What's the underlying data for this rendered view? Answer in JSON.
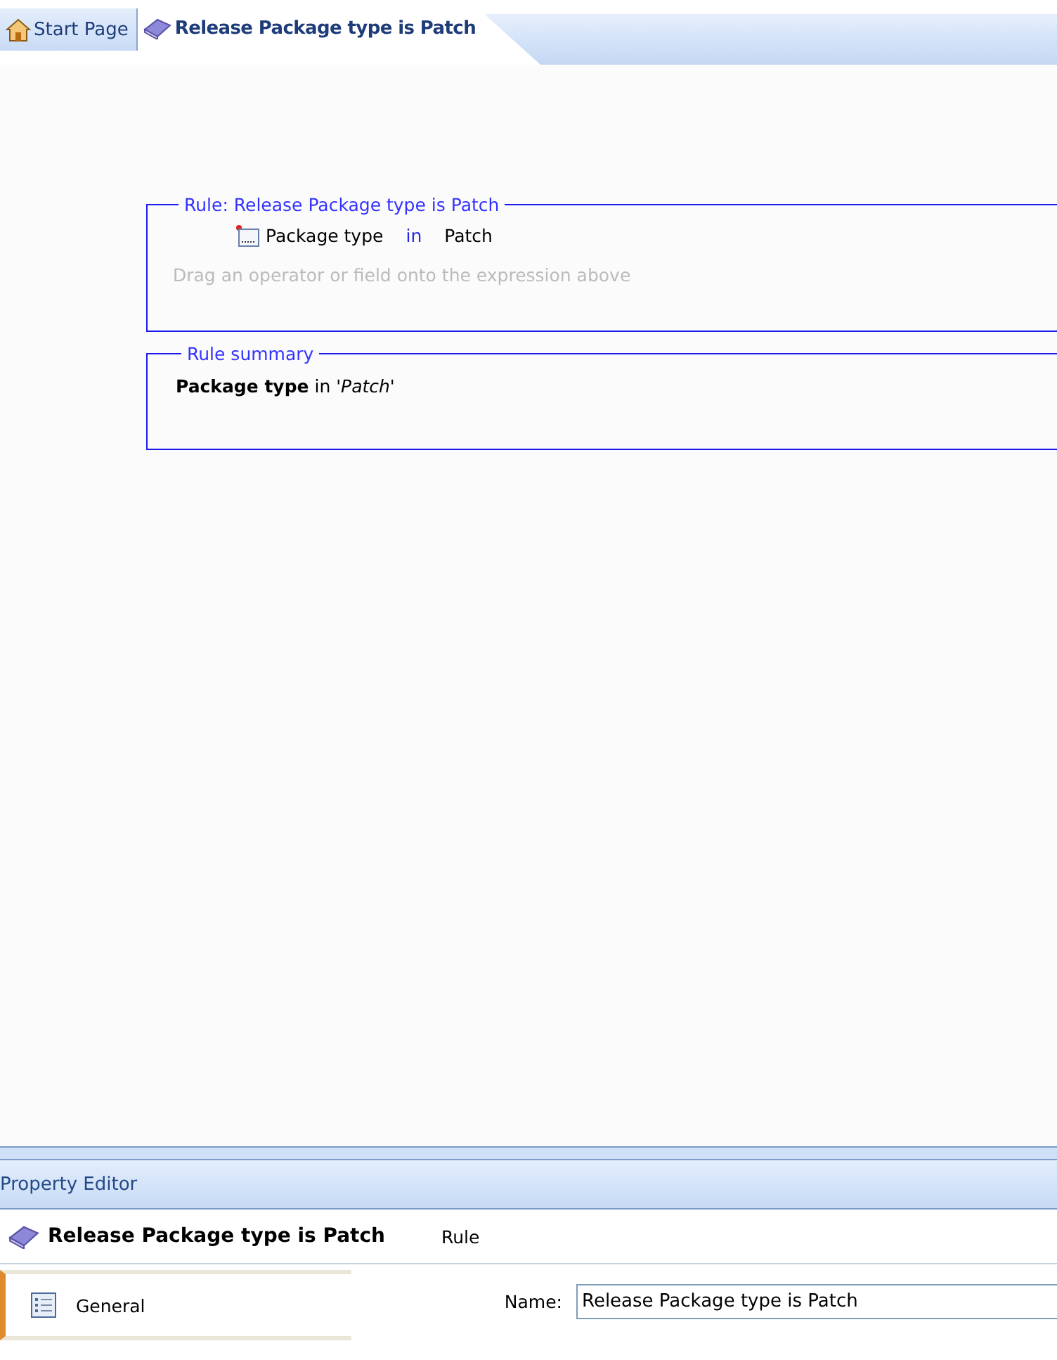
{
  "tabs": [
    {
      "label": "Start Page",
      "kind": "home",
      "selected": false
    },
    {
      "label": "Release Package type is Patch",
      "kind": "book",
      "selected": true
    }
  ],
  "rule": {
    "legend": "Rule: Release Package type is Patch",
    "expression": {
      "field": "Package type",
      "operator": "in",
      "value": "Patch"
    },
    "hint": "Drag an operator or field onto the expression above"
  },
  "summary": {
    "legend": "Rule summary",
    "text": "**Package type** in *'Patch'*"
  },
  "property_editor": {
    "title": "Property Editor",
    "object_name": "Release Package type is Patch",
    "object_type": "Rule",
    "sections": [
      {
        "label": "General",
        "selected": true
      }
    ],
    "fields": [
      {
        "label": "Name:",
        "value": "Release Package type is Patch"
      }
    ]
  }
}
